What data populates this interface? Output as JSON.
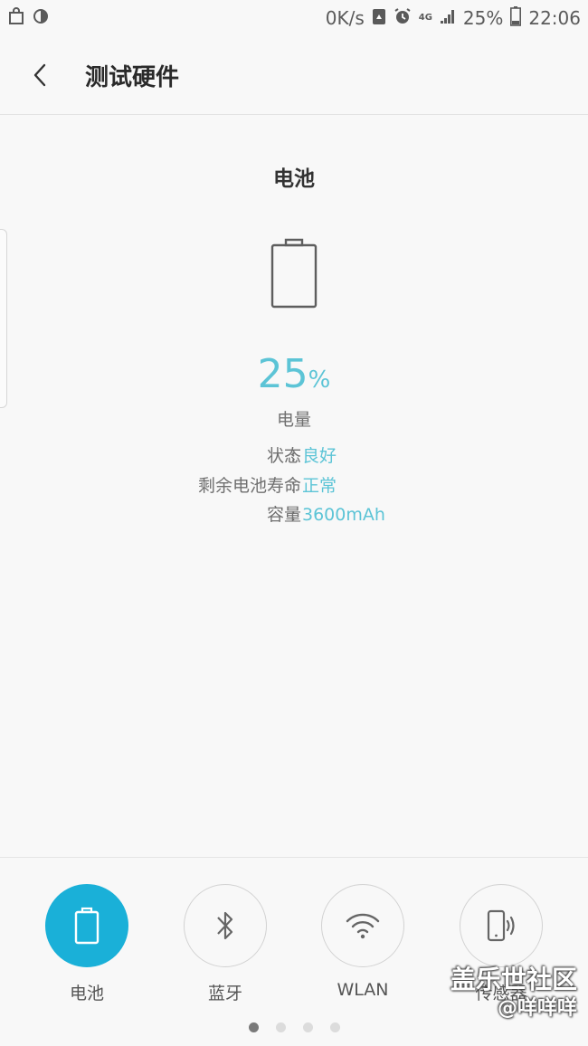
{
  "status_bar": {
    "net_speed": "0K/s",
    "network_type": "4G",
    "battery_percent": "25%",
    "time": "22:06"
  },
  "header": {
    "title": "测试硬件"
  },
  "battery_test": {
    "section_title": "电池",
    "percent_value": "25",
    "percent_unit": "%",
    "percent_label": "电量",
    "level_fraction": 0.25,
    "info": [
      {
        "key": "状态",
        "colon": ":",
        "value": "良好"
      },
      {
        "key": "剩余电池寿命",
        "colon": ":",
        "value": "正常"
      },
      {
        "key": "容量",
        "colon": ":",
        "value": "3600mAh"
      }
    ]
  },
  "bottom_nav": {
    "items": [
      {
        "label": "电池",
        "icon": "battery-icon",
        "active": true
      },
      {
        "label": "蓝牙",
        "icon": "bluetooth-icon",
        "active": false
      },
      {
        "label": "WLAN",
        "icon": "wifi-icon",
        "active": false
      },
      {
        "label": "传感器",
        "icon": "phone-sensor-icon",
        "active": false
      }
    ],
    "pages": 4,
    "current_page": 1
  },
  "watermark": {
    "main": "盖乐世社区",
    "sub": "@咩咩咩"
  },
  "colors": {
    "accent": "#5cc4d6",
    "active_nav": "#1ab0d8"
  }
}
